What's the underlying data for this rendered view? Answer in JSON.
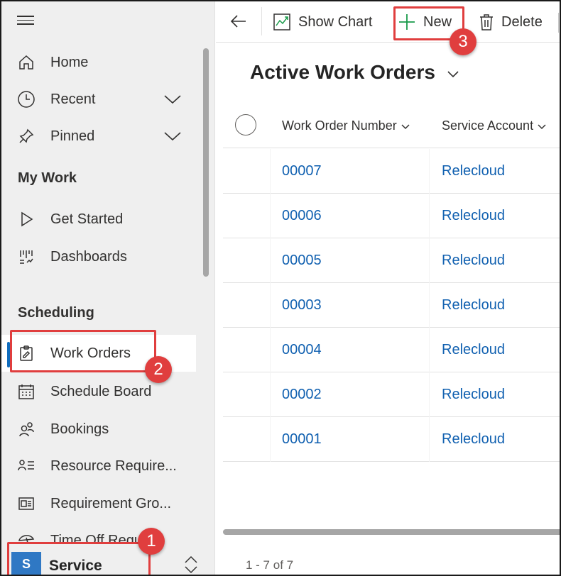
{
  "sidebar": {
    "items": [
      {
        "label": "Home"
      },
      {
        "label": "Recent"
      },
      {
        "label": "Pinned"
      },
      {
        "label": "Get Started"
      },
      {
        "label": "Dashboards"
      },
      {
        "label": "Work Orders"
      },
      {
        "label": "Schedule Board"
      },
      {
        "label": "Bookings"
      },
      {
        "label": "Resource Require..."
      },
      {
        "label": "Requirement Gro..."
      },
      {
        "label": "Time Off Requ..."
      }
    ],
    "sections": {
      "my_work": "My Work",
      "scheduling": "Scheduling"
    }
  },
  "area": {
    "avatar": "S",
    "name": "Service"
  },
  "toolbar": {
    "show_chart": "Show Chart",
    "new": "New",
    "delete": "Delete"
  },
  "view": {
    "title": "Active Work Orders"
  },
  "grid": {
    "columns": [
      "Work Order Number",
      "Service Account"
    ],
    "rows": [
      {
        "number": "00007",
        "account": "Relecloud"
      },
      {
        "number": "00006",
        "account": "Relecloud"
      },
      {
        "number": "00005",
        "account": "Relecloud"
      },
      {
        "number": "00003",
        "account": "Relecloud"
      },
      {
        "number": "00004",
        "account": "Relecloud"
      },
      {
        "number": "00002",
        "account": "Relecloud"
      },
      {
        "number": "00001",
        "account": "Relecloud"
      }
    ],
    "footer": "1 - 7 of 7"
  },
  "annotations": [
    "1",
    "2",
    "3"
  ],
  "colors": {
    "accent": "#0f6cbd",
    "link": "#1060b0",
    "annotation": "#e03e3e",
    "new_icon": "#1a9b4b",
    "area_avatar": "#2f78c4"
  }
}
